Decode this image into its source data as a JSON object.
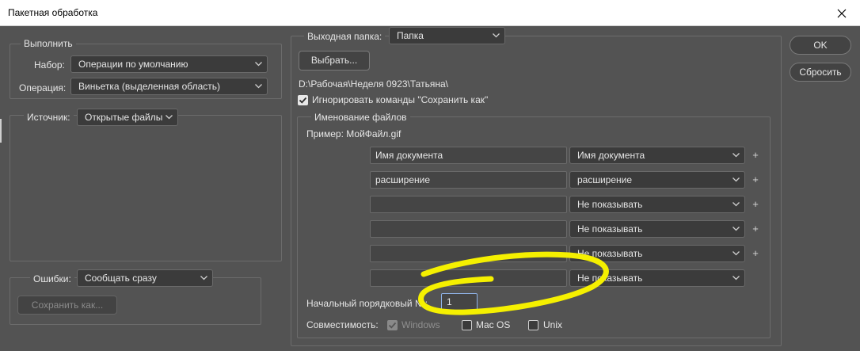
{
  "window": {
    "title": "Пакетная обработка"
  },
  "play": {
    "legend": "Выполнить",
    "set_label": "Набор:",
    "set_value": "Операции по умолчанию",
    "action_label": "Операция:",
    "action_value": "Виньетка (выделенная область)"
  },
  "source": {
    "label": "Источник:",
    "value": "Открытые файлы"
  },
  "errors": {
    "label": "Ошибки:",
    "value": "Сообщать сразу",
    "save_as": "Сохранить как..."
  },
  "destination": {
    "label": "Выходная папка:",
    "value": "Папка",
    "choose": "Выбрать...",
    "path": "D:\\Рабочая\\Неделя 0923\\Татьяна\\",
    "override_save_as": "Игнорировать команды \"Сохранить как\""
  },
  "naming": {
    "legend": "Именование файлов",
    "example": "Пример: МойФайл.gif",
    "rows": [
      {
        "field": "Имя документа",
        "select": "Имя документа",
        "plus": "+"
      },
      {
        "field": "расширение",
        "select": "расширение",
        "plus": "+"
      },
      {
        "field": "",
        "select": "Не показывать",
        "plus": "+"
      },
      {
        "field": "",
        "select": "Не показывать",
        "plus": "+"
      },
      {
        "field": "",
        "select": "Не показывать",
        "plus": "+"
      },
      {
        "field": "",
        "select": "Не показывать",
        "plus": ""
      }
    ],
    "serial_label": "Начальный порядковый №:",
    "serial_value": "1",
    "compat_label": "Совместимость:",
    "compat_windows": "Windows",
    "compat_mac": "Mac OS",
    "compat_unix": "Unix"
  },
  "buttons": {
    "ok": "OK",
    "reset": "Сбросить"
  },
  "annotation_color": "#f5f000"
}
